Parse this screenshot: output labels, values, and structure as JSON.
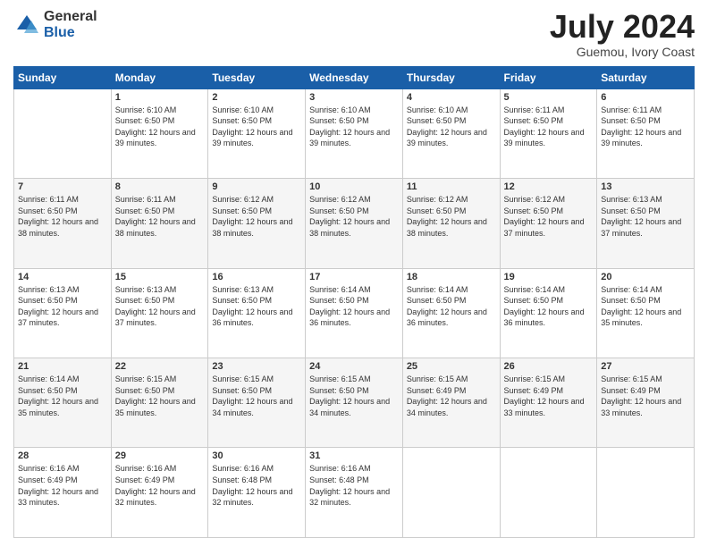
{
  "logo": {
    "general": "General",
    "blue": "Blue"
  },
  "header": {
    "month": "July 2024",
    "location": "Guemou, Ivory Coast"
  },
  "weekdays": [
    "Sunday",
    "Monday",
    "Tuesday",
    "Wednesday",
    "Thursday",
    "Friday",
    "Saturday"
  ],
  "weeks": [
    [
      {
        "day": "",
        "info": ""
      },
      {
        "day": "1",
        "info": "Sunrise: 6:10 AM\nSunset: 6:50 PM\nDaylight: 12 hours and 39 minutes."
      },
      {
        "day": "2",
        "info": "Sunrise: 6:10 AM\nSunset: 6:50 PM\nDaylight: 12 hours and 39 minutes."
      },
      {
        "day": "3",
        "info": "Sunrise: 6:10 AM\nSunset: 6:50 PM\nDaylight: 12 hours and 39 minutes."
      },
      {
        "day": "4",
        "info": "Sunrise: 6:10 AM\nSunset: 6:50 PM\nDaylight: 12 hours and 39 minutes."
      },
      {
        "day": "5",
        "info": "Sunrise: 6:11 AM\nSunset: 6:50 PM\nDaylight: 12 hours and 39 minutes."
      },
      {
        "day": "6",
        "info": "Sunrise: 6:11 AM\nSunset: 6:50 PM\nDaylight: 12 hours and 39 minutes."
      }
    ],
    [
      {
        "day": "7",
        "info": "Sunrise: 6:11 AM\nSunset: 6:50 PM\nDaylight: 12 hours and 38 minutes."
      },
      {
        "day": "8",
        "info": "Sunrise: 6:11 AM\nSunset: 6:50 PM\nDaylight: 12 hours and 38 minutes."
      },
      {
        "day": "9",
        "info": "Sunrise: 6:12 AM\nSunset: 6:50 PM\nDaylight: 12 hours and 38 minutes."
      },
      {
        "day": "10",
        "info": "Sunrise: 6:12 AM\nSunset: 6:50 PM\nDaylight: 12 hours and 38 minutes."
      },
      {
        "day": "11",
        "info": "Sunrise: 6:12 AM\nSunset: 6:50 PM\nDaylight: 12 hours and 38 minutes."
      },
      {
        "day": "12",
        "info": "Sunrise: 6:12 AM\nSunset: 6:50 PM\nDaylight: 12 hours and 37 minutes."
      },
      {
        "day": "13",
        "info": "Sunrise: 6:13 AM\nSunset: 6:50 PM\nDaylight: 12 hours and 37 minutes."
      }
    ],
    [
      {
        "day": "14",
        "info": "Sunrise: 6:13 AM\nSunset: 6:50 PM\nDaylight: 12 hours and 37 minutes."
      },
      {
        "day": "15",
        "info": "Sunrise: 6:13 AM\nSunset: 6:50 PM\nDaylight: 12 hours and 37 minutes."
      },
      {
        "day": "16",
        "info": "Sunrise: 6:13 AM\nSunset: 6:50 PM\nDaylight: 12 hours and 36 minutes."
      },
      {
        "day": "17",
        "info": "Sunrise: 6:14 AM\nSunset: 6:50 PM\nDaylight: 12 hours and 36 minutes."
      },
      {
        "day": "18",
        "info": "Sunrise: 6:14 AM\nSunset: 6:50 PM\nDaylight: 12 hours and 36 minutes."
      },
      {
        "day": "19",
        "info": "Sunrise: 6:14 AM\nSunset: 6:50 PM\nDaylight: 12 hours and 36 minutes."
      },
      {
        "day": "20",
        "info": "Sunrise: 6:14 AM\nSunset: 6:50 PM\nDaylight: 12 hours and 35 minutes."
      }
    ],
    [
      {
        "day": "21",
        "info": "Sunrise: 6:14 AM\nSunset: 6:50 PM\nDaylight: 12 hours and 35 minutes."
      },
      {
        "day": "22",
        "info": "Sunrise: 6:15 AM\nSunset: 6:50 PM\nDaylight: 12 hours and 35 minutes."
      },
      {
        "day": "23",
        "info": "Sunrise: 6:15 AM\nSunset: 6:50 PM\nDaylight: 12 hours and 34 minutes."
      },
      {
        "day": "24",
        "info": "Sunrise: 6:15 AM\nSunset: 6:50 PM\nDaylight: 12 hours and 34 minutes."
      },
      {
        "day": "25",
        "info": "Sunrise: 6:15 AM\nSunset: 6:49 PM\nDaylight: 12 hours and 34 minutes."
      },
      {
        "day": "26",
        "info": "Sunrise: 6:15 AM\nSunset: 6:49 PM\nDaylight: 12 hours and 33 minutes."
      },
      {
        "day": "27",
        "info": "Sunrise: 6:15 AM\nSunset: 6:49 PM\nDaylight: 12 hours and 33 minutes."
      }
    ],
    [
      {
        "day": "28",
        "info": "Sunrise: 6:16 AM\nSunset: 6:49 PM\nDaylight: 12 hours and 33 minutes."
      },
      {
        "day": "29",
        "info": "Sunrise: 6:16 AM\nSunset: 6:49 PM\nDaylight: 12 hours and 32 minutes."
      },
      {
        "day": "30",
        "info": "Sunrise: 6:16 AM\nSunset: 6:48 PM\nDaylight: 12 hours and 32 minutes."
      },
      {
        "day": "31",
        "info": "Sunrise: 6:16 AM\nSunset: 6:48 PM\nDaylight: 12 hours and 32 minutes."
      },
      {
        "day": "",
        "info": ""
      },
      {
        "day": "",
        "info": ""
      },
      {
        "day": "",
        "info": ""
      }
    ]
  ]
}
